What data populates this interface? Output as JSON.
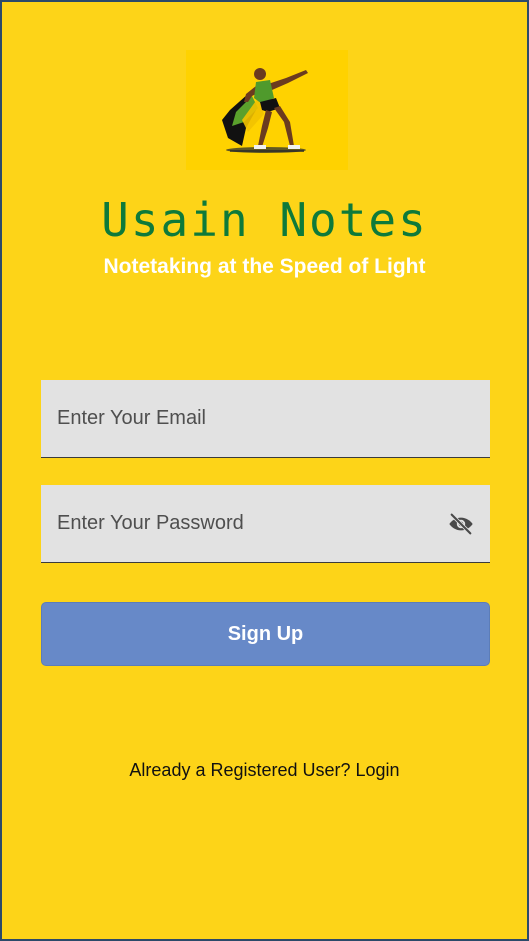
{
  "app": {
    "title": "Usain Notes",
    "tagline": "Notetaking at the Speed of Light",
    "logo_icon": "sprinter-lightning-pose-icon"
  },
  "form": {
    "email_placeholder": "Enter Your Email",
    "email_value": "",
    "password_placeholder": "Enter Your Password",
    "password_value": "",
    "password_toggle_icon": "eye-off-icon",
    "signup_label": "Sign Up",
    "login_link": "Already a Registered User? Login"
  },
  "colors": {
    "background": "#FDD418",
    "title": "#0E7A3A",
    "tagline": "#FFFFFF",
    "field_background": "#E2E2E2",
    "button": "#6789C8",
    "button_text": "#FFFFFF"
  }
}
